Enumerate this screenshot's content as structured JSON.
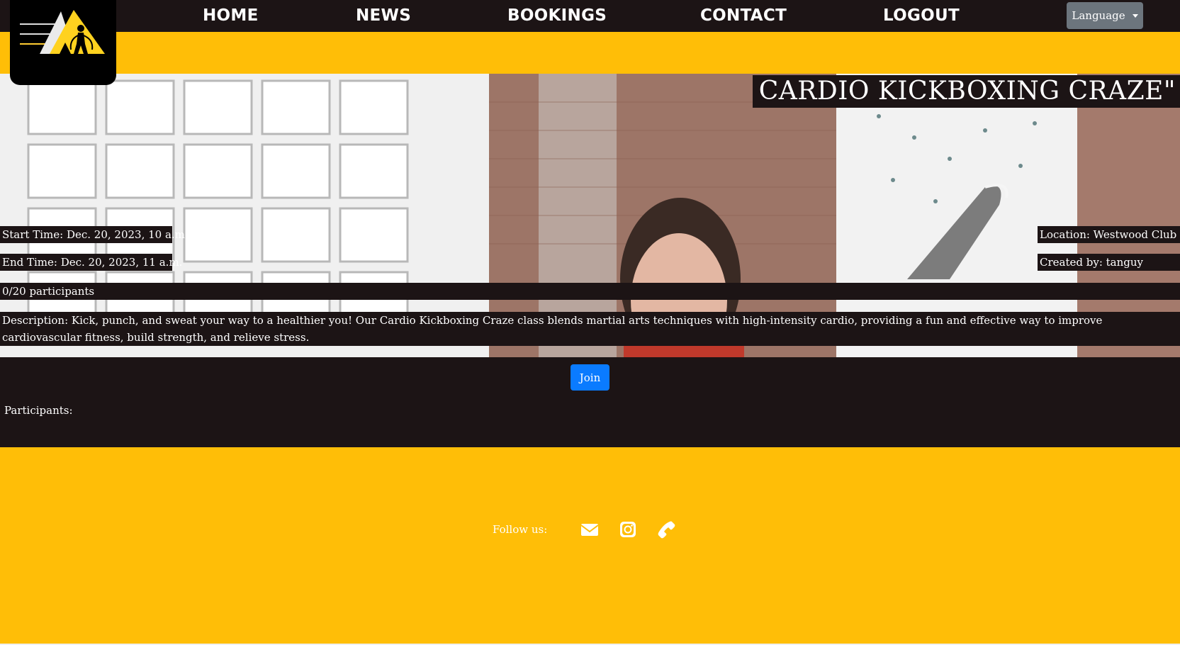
{
  "nav": {
    "home": "HOME",
    "news": "NEWS",
    "bookings": "BOOKINGS",
    "contact": "CONTACT",
    "logout": "LOGOUT",
    "language": "Language"
  },
  "event": {
    "title": "CARDIO KICKBOXING CRAZE\"",
    "start_time": "Start Time: Dec. 20, 2023, 10 a.m.",
    "end_time": "End Time: Dec. 20, 2023, 11 a.m.",
    "location": "Location: Westwood Club",
    "created_by": "Created by: tanguy",
    "participants_count": "0/20 participants",
    "description": "Description: Kick, punch, and sweat your way to a healthier you! Our Cardio Kickboxing Craze class blends martial arts techniques with high-intensity cardio, providing a fun and effective way to improve cardiovascular fitness, build strength, and relieve stress.",
    "join_label": "Join",
    "participants_label": "Participants:"
  },
  "footer": {
    "follow_label": "Follow us:",
    "icons": [
      "envelope-icon",
      "instagram-icon",
      "phone-icon"
    ]
  },
  "colors": {
    "accent": "#ffbe07",
    "dark": "#1c1415",
    "primary_button": "#0a7bff",
    "secondary_button": "#6c757d"
  }
}
